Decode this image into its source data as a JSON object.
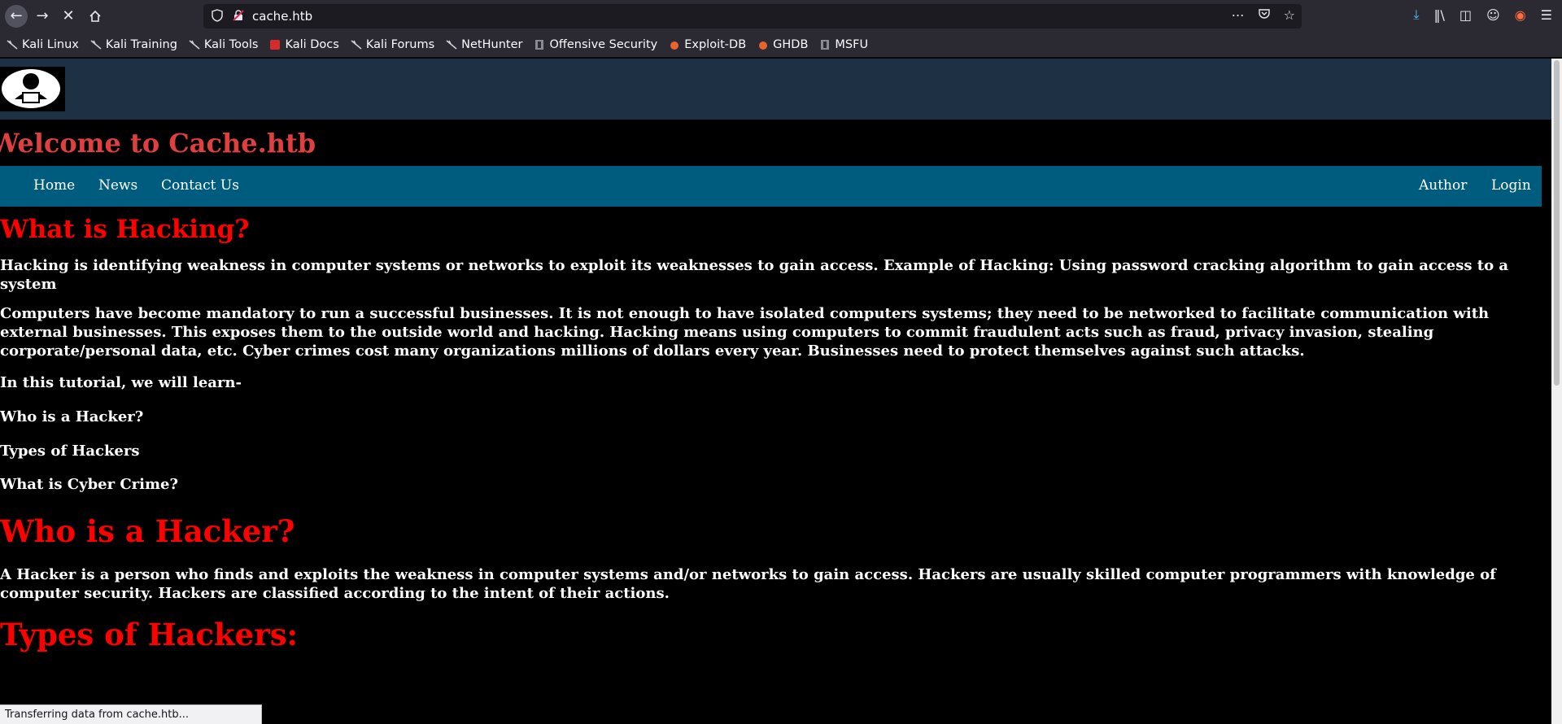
{
  "browser": {
    "url": "cache.htb",
    "bookmarks": [
      {
        "label": "Kali Linux",
        "icon": "kali-dragon-icon"
      },
      {
        "label": "Kali Training",
        "icon": "kali-dragon-icon"
      },
      {
        "label": "Kali Tools",
        "icon": "kali-dragon-icon"
      },
      {
        "label": "Kali Docs",
        "icon": "kali-docs-icon"
      },
      {
        "label": "Kali Forums",
        "icon": "kali-dragon-icon"
      },
      {
        "label": "NetHunter",
        "icon": "kali-dragon-icon"
      },
      {
        "label": "Offensive Security",
        "icon": "offsec-icon"
      },
      {
        "label": "Exploit-DB",
        "icon": "exploit-db-icon"
      },
      {
        "label": "GHDB",
        "icon": "ghdb-icon"
      },
      {
        "label": "MSFU",
        "icon": "msfu-icon"
      }
    ],
    "status_text": "Transferring data from cache.htb...",
    "colors": {
      "chrome": "#2b2a33",
      "urlbar": "#1c1b22",
      "download_accent": "#54c1ff"
    }
  },
  "site": {
    "title": "Welcome to Cache.htb",
    "nav_left": [
      "Home",
      "News",
      "Contact Us"
    ],
    "nav_right": [
      "Author",
      "Login"
    ],
    "colors": {
      "header": "#1d3044",
      "navbar": "#005c7f",
      "title": "#e03f3f",
      "heading": "#ff0000"
    }
  },
  "content": {
    "h_what": "What is Hacking?",
    "p1": "Hacking is identifying weakness in computer systems or networks to exploit its weaknesses to gain access. Example of Hacking: Using password cracking algorithm to gain access to a system",
    "p2": "Computers have become mandatory to run a successful businesses. It is not enough to have isolated computers systems; they need to be networked to facilitate communication with external businesses. This exposes them to the outside world and hacking. Hacking means using computers to commit fraudulent acts such as fraud, privacy invasion, stealing corporate/personal data, etc. Cyber crimes cost many organizations millions of dollars every year. Businesses need to protect themselves against such attacks.",
    "p3": "In this tutorial, we will learn-",
    "p4": "Who is a Hacker?",
    "p5": "Types of Hackers",
    "p6": "What is Cyber Crime?",
    "h_who": "Who is a Hacker?",
    "p7": "A Hacker is a person who finds and exploits the weakness in computer systems and/or networks to gain access. Hackers are usually skilled computer programmers with knowledge of computer security. Hackers are classified according to the intent of their actions.",
    "h_types": "Types of Hackers:"
  }
}
